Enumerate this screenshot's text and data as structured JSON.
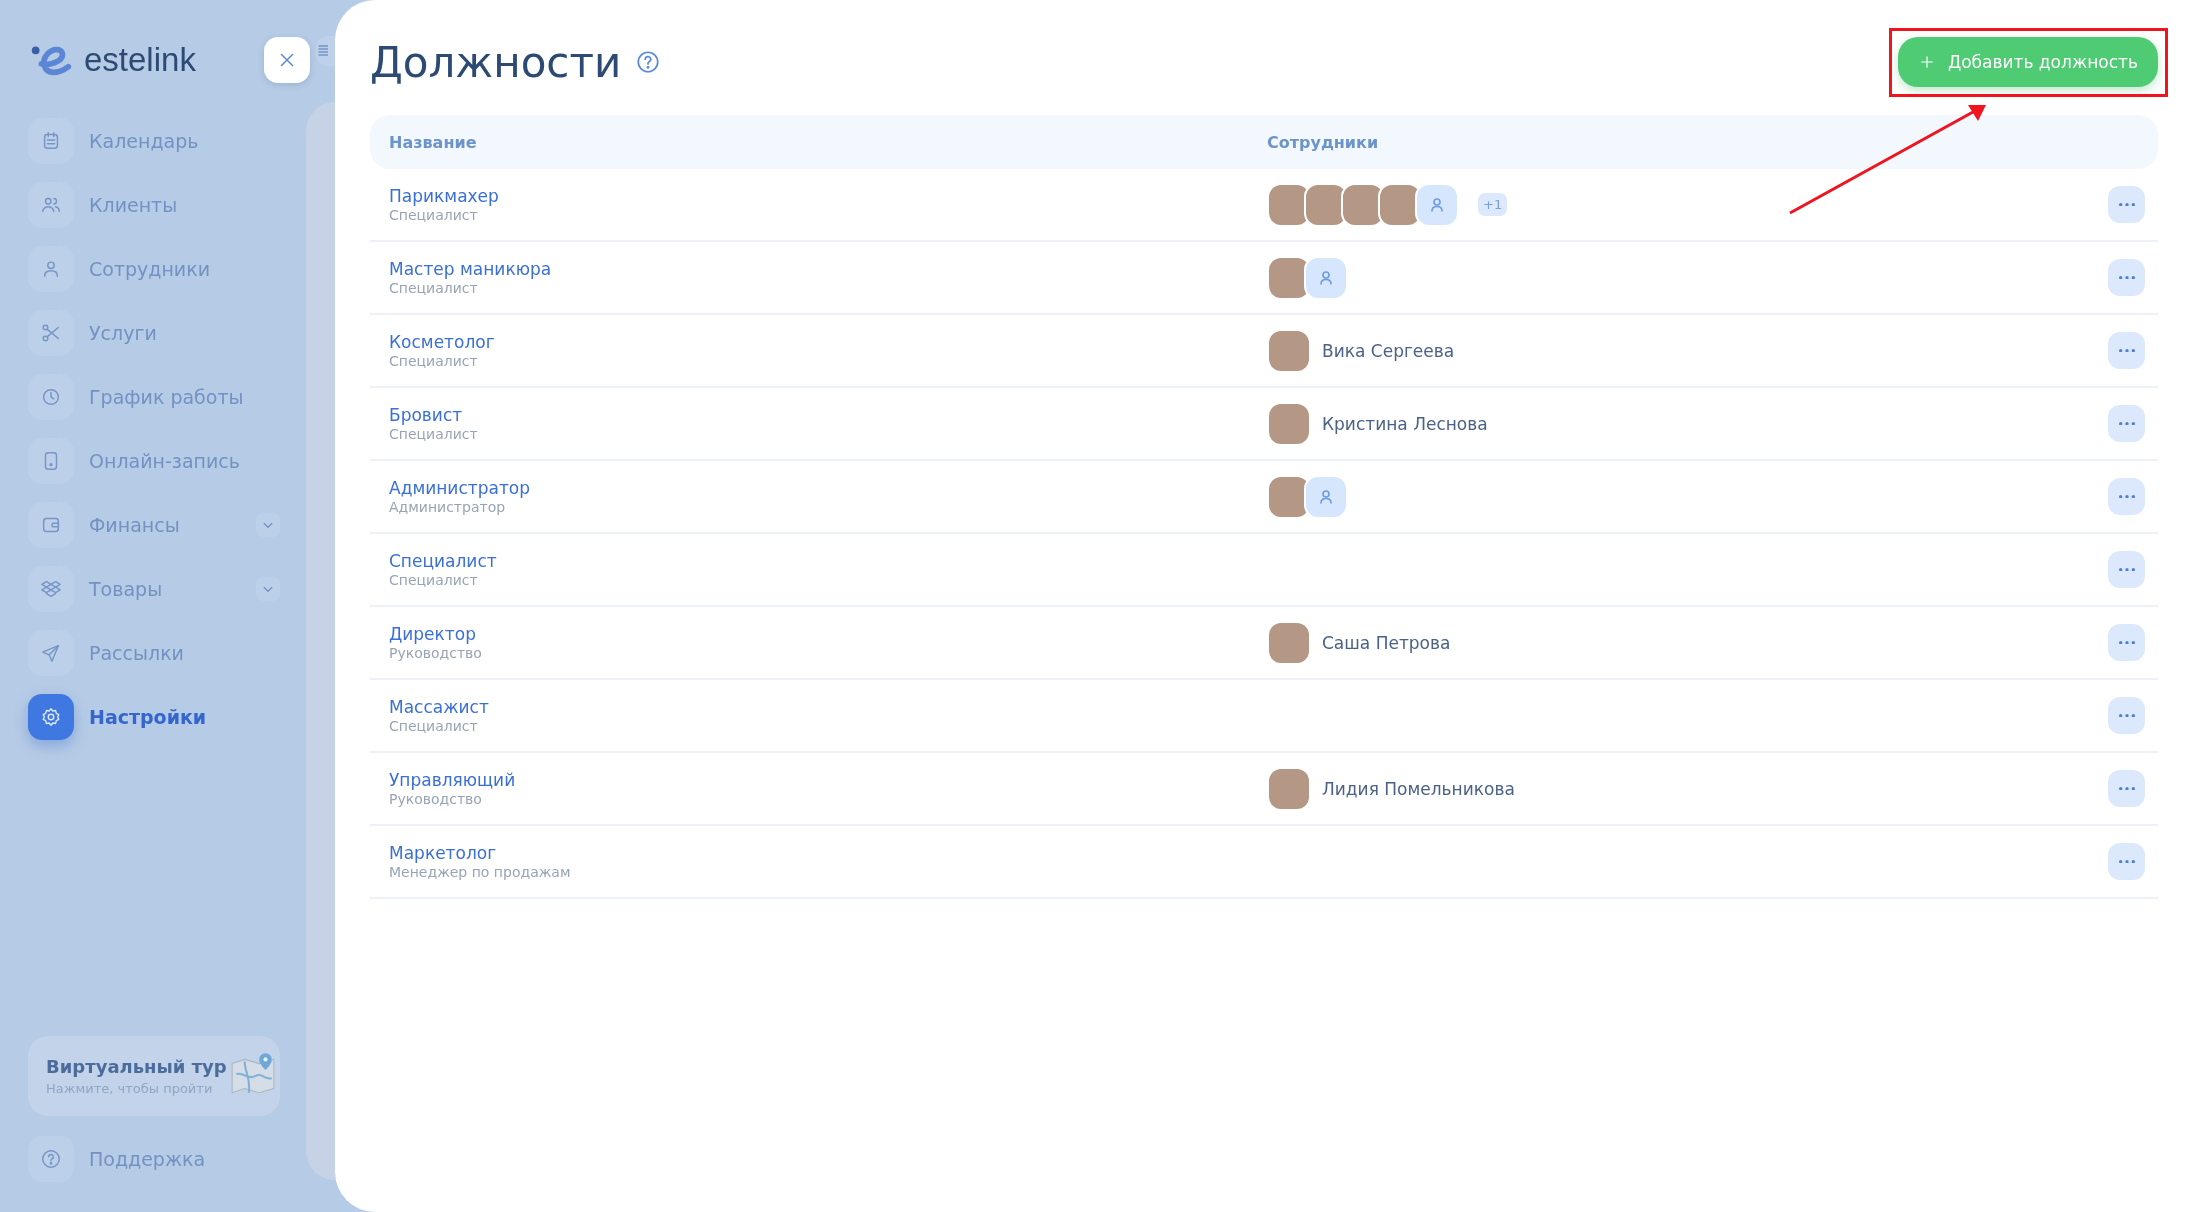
{
  "sidebar": {
    "logo": "estelink",
    "items": [
      {
        "label": "Календарь",
        "selected": false,
        "expandable": false
      },
      {
        "label": "Клиенты",
        "selected": false,
        "expandable": false
      },
      {
        "label": "Сотрудники",
        "selected": false,
        "expandable": false
      },
      {
        "label": "Услуги",
        "selected": false,
        "expandable": false
      },
      {
        "label": "График работы",
        "selected": false,
        "expandable": false
      },
      {
        "label": "Онлайн-запись",
        "selected": false,
        "expandable": false
      },
      {
        "label": "Финансы",
        "selected": false,
        "expandable": true
      },
      {
        "label": "Товары",
        "selected": false,
        "expandable": true
      },
      {
        "label": "Рассылки",
        "selected": false,
        "expandable": false
      },
      {
        "label": "Настройки",
        "selected": true,
        "expandable": false
      }
    ],
    "tour_card": {
      "title": "Виртуальный тур",
      "subtitle": "Нажмите, чтобы пройти"
    },
    "support": {
      "label": "Поддержка"
    }
  },
  "title": "Должности",
  "add_button": {
    "label": "Добавить должность"
  },
  "table": {
    "columns": [
      "Название",
      "Сотрудники"
    ],
    "rows": [
      {
        "name": "Парикмахер",
        "group": "Специалист",
        "employees": [
          {
            "kind": "photo"
          },
          {
            "kind": "photo"
          },
          {
            "kind": "photo"
          },
          {
            "kind": "photo"
          },
          {
            "kind": "placeholder"
          }
        ],
        "more": "+1"
      },
      {
        "name": "Мастер маникюра",
        "group": "Специалист",
        "employees": [
          {
            "kind": "photo"
          },
          {
            "kind": "placeholder"
          }
        ]
      },
      {
        "name": "Косметолог",
        "group": "Специалист",
        "employees": [
          {
            "kind": "photo",
            "name": "Вика Сергеева"
          }
        ]
      },
      {
        "name": "Бровист",
        "group": "Специалист",
        "employees": [
          {
            "kind": "photo",
            "name": "Кристина Леснова"
          }
        ]
      },
      {
        "name": "Администратор",
        "group": "Администратор",
        "employees": [
          {
            "kind": "photo"
          },
          {
            "kind": "placeholder"
          }
        ]
      },
      {
        "name": "Специалист",
        "group": "Специалист",
        "employees": []
      },
      {
        "name": "Директор",
        "group": "Руководство",
        "employees": [
          {
            "kind": "photo",
            "name": "Саша Петрова"
          }
        ]
      },
      {
        "name": "Массажист",
        "group": "Специалист",
        "employees": []
      },
      {
        "name": "Управляющий",
        "group": "Руководство",
        "employees": [
          {
            "kind": "photo",
            "name": "Лидия Помельникова"
          }
        ]
      },
      {
        "name": "Маркетолог",
        "group": "Менеджер по продажам",
        "employees": []
      }
    ]
  }
}
